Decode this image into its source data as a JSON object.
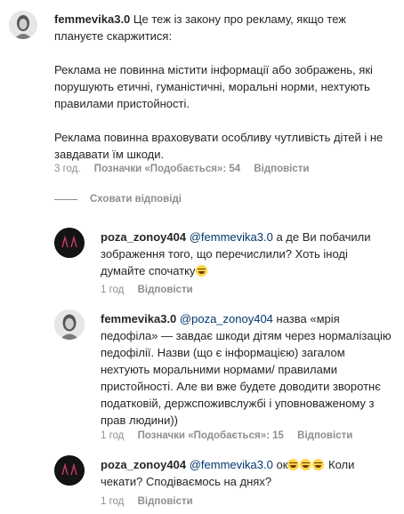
{
  "comments": [
    {
      "username": "femmevika3.0",
      "paragraphs": [
        "Це теж із закону про рекламу, якщо теж плануєте скаржитися:",
        "Реклама не повинна містити інформації або зображень, які порушують етичні, гуманістичні, моральні норми, нехтують правилами пристойності.",
        "Реклама повинна враховувати особливу чутливість дітей і не завдавати їм шкоди."
      ],
      "time": "3 год.",
      "likes": "Позначки «Подобається»: 54",
      "reply_label": "Відповісти"
    },
    {
      "username": "poza_zonoy404",
      "mention": "@femmevika3.0",
      "text": "а де Ви побачили зображення того, що перечислили? Хоть іноді думайте спочатку",
      "emoji": "laughing-emoji",
      "time": "1 год",
      "reply_label": "Відповісти"
    },
    {
      "username": "femmevika3.0",
      "mention": "@poza_zonoy404",
      "text": "назва «мрія педофіла» — завдає шкоди дітям через нормалізацію педофілії. Назви (що є інформацією) загалом нехтують моральними нормами/ правилами пристойності. Але ви вже будете доводити зворотнє податковій, держспоживслужбі і уповноваженому з прав людини))",
      "time": "1 год",
      "likes": "Позначки «Подобається»: 15",
      "reply_label": "Відповісти"
    },
    {
      "username": "poza_zonoy404",
      "mention": "@femmevika3.0",
      "text_before": "ок",
      "text_after": "Коли чекати? Сподіваємось на днях?",
      "emoji": "laughing-emoji",
      "time": "1 год",
      "reply_label": "Відповісти"
    }
  ],
  "hide_replies_label": "Сховати відповіді"
}
